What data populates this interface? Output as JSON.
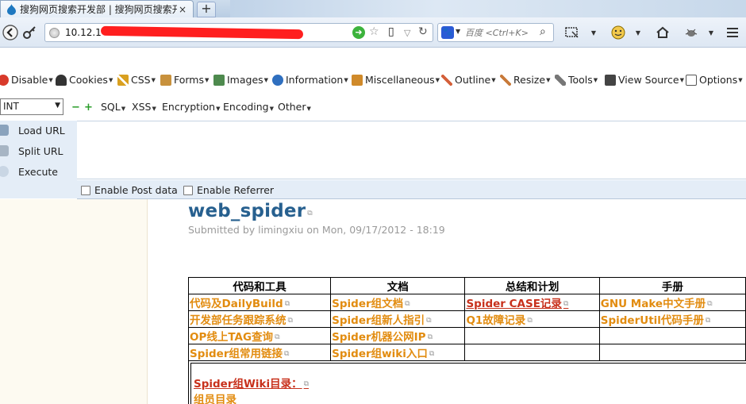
{
  "tab": {
    "title": "搜狗网页搜索开发部 | 搜狗网页搜索开...",
    "close": "×"
  },
  "new_tab": "+",
  "nav": {
    "url": "10.12.1",
    "search_placeholder": "百度 <Ctrl+K>"
  },
  "hackbar_menu": [
    {
      "label": "Disable",
      "icon": "disable-icon",
      "color": "#d83a2b"
    },
    {
      "label": "Cookies",
      "icon": "cookies-icon",
      "color": "#333333"
    },
    {
      "label": "CSS",
      "icon": "css-icon",
      "color": "#d9a020"
    },
    {
      "label": "Forms",
      "icon": "forms-icon",
      "color": "#c8913c"
    },
    {
      "label": "Images",
      "icon": "images-icon",
      "color": "#4e8a4e"
    },
    {
      "label": "Information",
      "icon": "information-icon",
      "color": "#2f6fbf"
    },
    {
      "label": "Miscellaneous",
      "icon": "miscellaneous-icon",
      "color": "#d08a2a"
    },
    {
      "label": "Outline",
      "icon": "outline-icon",
      "color": "#d4603a"
    },
    {
      "label": "Resize",
      "icon": "resize-icon",
      "color": "#c87a3a"
    },
    {
      "label": "Tools",
      "icon": "tools-icon",
      "color": "#777777"
    },
    {
      "label": "View Source",
      "icon": "view-source-icon",
      "color": "#444444"
    },
    {
      "label": "Options",
      "icon": "options-icon",
      "color": "#555555"
    }
  ],
  "hackbar_row2": {
    "select_value": "INT",
    "items": [
      "SQL",
      "XSS",
      "Encryption",
      "Encoding",
      "Other"
    ]
  },
  "hackbar_actions": [
    "Load URL",
    "Split URL",
    "Execute"
  ],
  "hackbar_options": [
    "Enable Post data",
    "Enable Referrer"
  ],
  "page": {
    "title": "web_spider",
    "submitted": "Submitted by limingxiu on Mon, 09/17/2012 - 18:19",
    "table": {
      "headers": [
        "代码和工具",
        "文档",
        "总结和计划",
        "手册"
      ],
      "rows": [
        [
          "代码及DailyBuild",
          "Spider组文档",
          "Spider CASE记录",
          "GNU Make中文手册"
        ],
        [
          "开发部任务跟踪系统",
          "Spider组新人指引",
          "Q1故障记录",
          "SpiderUtil代码手册"
        ],
        [
          "OP线上TAG查询",
          "Spider机器公网IP",
          "",
          ""
        ],
        [
          "Spider组常用链接",
          "Spider组wiki入口",
          "",
          ""
        ]
      ]
    },
    "wiki_dir": "Spider组Wiki目录：",
    "members": "组员目录"
  }
}
